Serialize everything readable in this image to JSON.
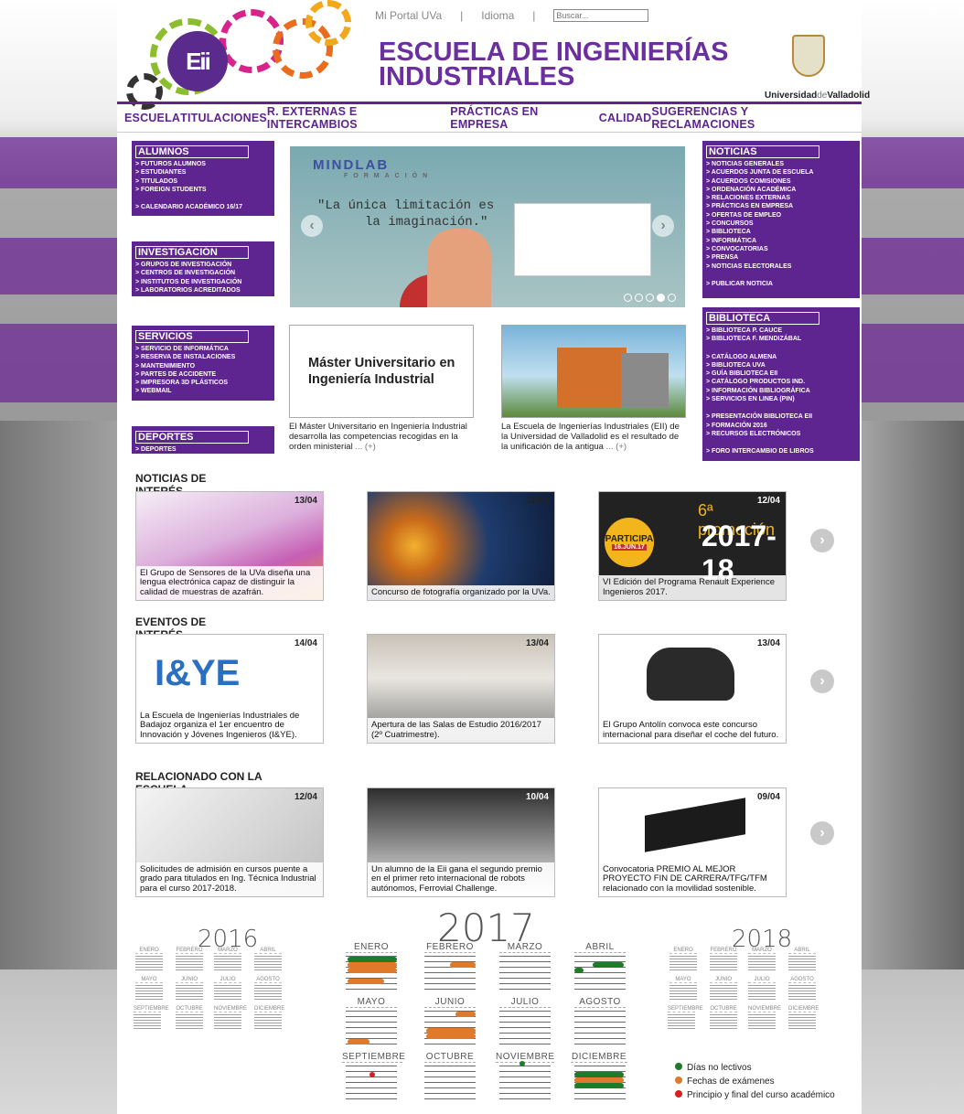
{
  "header": {
    "logo_text": "Eii",
    "top_links": [
      "Mi Portal UVa",
      "Idioma"
    ],
    "search_placeholder": "Buscar...",
    "title_line1": "ESCUELA DE INGENIERÍAS",
    "title_line2": "INDUSTRIALES",
    "uva_bold1": "Universidad",
    "uva_light": "de",
    "uva_bold2": "Valladolid"
  },
  "nav": [
    "ESCUELA",
    "TITULACIONES",
    "R. EXTERNAS E INTERCAMBIOS",
    "PRÁCTICAS EN EMPRESA",
    "CALIDAD",
    "SUGERENCIAS Y RECLAMACIONES"
  ],
  "left_boxes": {
    "alumnos": {
      "title": "ALUMNOS",
      "items": [
        "> FUTUROS ALUMNOS",
        "> ESTUDIANTES",
        "> TITULADOS",
        "> FOREIGN STUDENTS",
        "> CALENDARIO ACADÉMICO 16/17"
      ]
    },
    "investigacion": {
      "title": "INVESTIGACIÓN",
      "items": [
        "> GRUPOS DE INVESTIGACIÓN",
        "> CENTROS DE INVESTIGACIÓN",
        "> INSTITUTOS DE INVESTIGACIÓN",
        "> LABORATORIOS ACREDITADOS"
      ]
    },
    "servicios": {
      "title": "SERVICIOS",
      "items": [
        "> SERVICIO DE INFORMÁTICA",
        "> RESERVA DE INSTALACIONES",
        "> MANTENIMIENTO",
        "> PARTES DE ACCIDENTE",
        "> IMPRESORA 3D PLÁSTICOS",
        "> WEBMAIL"
      ]
    },
    "deportes": {
      "title": "DEPORTES",
      "items": [
        "> DEPORTES"
      ]
    }
  },
  "right_boxes": {
    "noticias": {
      "title": "NOTICIAS",
      "items": [
        "> NOTICIAS GENERALES",
        "> ACUERDOS JUNTA DE ESCUELA",
        "> ACUERDOS COMISIONES",
        "> ORDENACIÓN ACADÉMICA",
        "> RELACIONES EXTERNAS",
        "> PRÁCTICAS EN EMPRESA",
        "> OFERTAS DE EMPLEO",
        "> CONCURSOS",
        "> BIBLIOTECA",
        "> INFORMÁTICA",
        "> CONVOCATORIAS",
        "> PRENSA",
        "> NOTICIAS ELECTORALES",
        "> PUBLICAR NOTICIA"
      ]
    },
    "biblioteca": {
      "title": "BIBLIOTECA",
      "items": [
        "> BIBLIOTECA P. CAUCE",
        "> BIBLIOTECA F. MENDIZÁBAL",
        "> CATÁLOGO ALMENA",
        "> BIBLIOTECA UVA",
        "> GUÍA BIBLIOTECA EII",
        "> CATÁLOGO PRODUCTOS IND.",
        "> INFORMACIÓN BIBLIOGRÁFICA",
        "> SERVICIOS EN LINEA (PIN)",
        "> PRESENTACIÓN BIBLIOTECA EII",
        "> FORMACIÓN 2016",
        "> RECURSOS ELECTRÓNICOS",
        "> FORO INTERCAMBIO DE LIBROS"
      ]
    }
  },
  "slider": {
    "brand": "MINDLAB",
    "brand_sub": "FORMACIÓN",
    "quote1": "\"La única limitación es",
    "quote2": "la imaginación.\""
  },
  "features": [
    {
      "image_text1": "Máster Universitario en",
      "image_text2": "Ingeniería Industrial",
      "text": "El Máster Universitario en Ingeniería Industrial desarrolla las competencias recogidas en la orden ministerial",
      "more": "... (+)"
    },
    {
      "text": "La Escuela de Ingenierías Industriales (EII) de la Universidad de Valladolid es el resultado de la unificación de la antigua",
      "more": "... (+)"
    }
  ],
  "sections": {
    "noticias": {
      "title": "NOTICIAS DE INTERÉS",
      "cards": [
        {
          "date": "13/04",
          "text": "El Grupo de Sensores de la UVa diseña una lengua electrónica capaz de distinguir la calidad de muestras de azafrán."
        },
        {
          "date": "12/04",
          "text": "Concurso de fotografía organizado por la UVa."
        },
        {
          "date": "12/04",
          "text": "VI Edición del Programa Renault Experience Ingenieros 2017.",
          "promo": "6ª promoción",
          "promo_year": "2017-18",
          "badge": "PARTICIPA",
          "badge_date": "16.JUN.17"
        }
      ]
    },
    "eventos": {
      "title": "EVENTOS DE INTERÉS",
      "cards": [
        {
          "date": "14/04",
          "text": "La Escuela de Ingenierías Industriales de Badajoz organiza el 1er encuentro de Innovación y Jóvenes Ingenieros (I&YE).",
          "logo": "I&YE"
        },
        {
          "date": "13/04",
          "text": "Apertura de las Salas de Estudio 2016/2017 (2º Cuatrimestre)."
        },
        {
          "date": "13/04",
          "text": "El Grupo Antolín convoca este concurso internacional para diseñar el coche del futuro."
        }
      ]
    },
    "relacionado": {
      "title": "RELACIONADO CON LA ESCUELA",
      "cards": [
        {
          "date": "12/04",
          "text": "Solicitudes de admisión en cursos puente a grado para titulados en Ing. Técnica Industrial para el curso 2017-2018."
        },
        {
          "date": "10/04",
          "text": "Un alumno de la Eii gana el segundo premio en el primer reto internacional de robots autónomos, Ferrovial Challenge."
        },
        {
          "date": "09/04",
          "text": "Convocatoria PREMIO AL MEJOR PROYECTO FIN DE CARRERA/TFG/TFM relacionado con la movilidad sostenible."
        }
      ]
    }
  },
  "calendar": {
    "years": [
      "2016",
      "2017",
      "2018"
    ],
    "months": [
      "ENERO",
      "FEBRERO",
      "MARZO",
      "ABRIL",
      "MAYO",
      "JUNIO",
      "JULIO",
      "AGOSTO",
      "SEPTIEMBRE",
      "OCTUBRE",
      "NOVIEMBRE",
      "DICIEMBRE"
    ],
    "legend": [
      "Días no lectivos",
      "Fechas de exámenes",
      "Principio y final del curso académico"
    ],
    "legend_colors": [
      "#1f7a2a",
      "#e07a2a",
      "#d61f1f"
    ]
  }
}
